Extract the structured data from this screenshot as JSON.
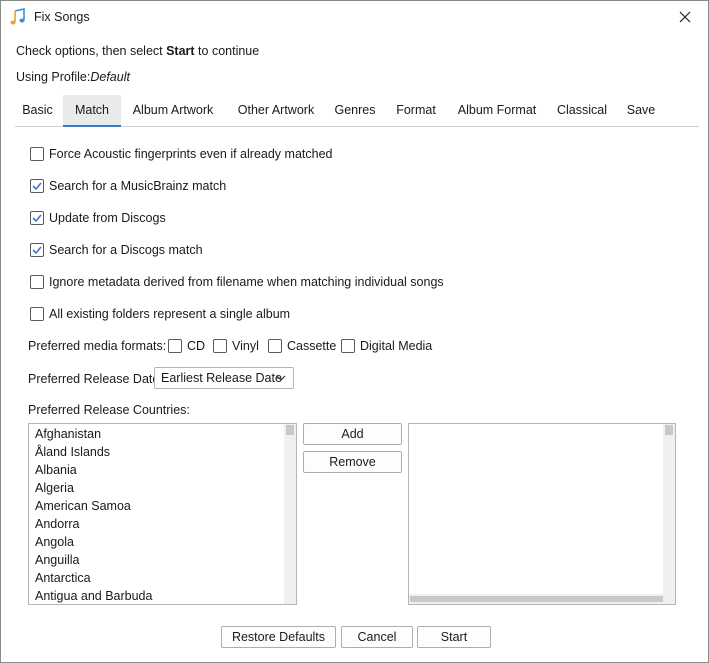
{
  "window": {
    "title": "Fix Songs",
    "icon": "music-note-icon"
  },
  "instructions": {
    "prefix": "Check options, then select ",
    "bold": "Start",
    "suffix": " to continue"
  },
  "profile": {
    "label": "Using Profile:",
    "value": "Default"
  },
  "tabs": [
    {
      "label": "Basic"
    },
    {
      "label": "Match",
      "active": true
    },
    {
      "label": "Album Artwork"
    },
    {
      "label": "Other Artwork"
    },
    {
      "label": "Genres"
    },
    {
      "label": "Format"
    },
    {
      "label": "Album Format"
    },
    {
      "label": "Classical"
    },
    {
      "label": "Save"
    }
  ],
  "options": [
    {
      "label": "Force Acoustic fingerprints even if already matched",
      "checked": false
    },
    {
      "label": "Search for a MusicBrainz match",
      "checked": true
    },
    {
      "label": "Update from Discogs",
      "checked": true
    },
    {
      "label": "Search for a Discogs match",
      "checked": true
    },
    {
      "label": "Ignore metadata derived from filename when matching individual songs",
      "checked": false
    },
    {
      "label": "All existing folders represent a single album",
      "checked": false
    }
  ],
  "media_formats": {
    "label": "Preferred media formats:",
    "items": [
      {
        "label": "CD",
        "checked": false
      },
      {
        "label": "Vinyl",
        "checked": false
      },
      {
        "label": "Cassette",
        "checked": false
      },
      {
        "label": "Digital Media",
        "checked": false
      }
    ]
  },
  "release_date": {
    "label": "Preferred Release Date:",
    "value": "Earliest Release Date"
  },
  "countries": {
    "label": "Preferred Release Countries:",
    "available": [
      "Afghanistan",
      "Åland Islands",
      "Albania",
      "Algeria",
      "American Samoa",
      "Andorra",
      "Angola",
      "Anguilla",
      "Antarctica",
      "Antigua and Barbuda"
    ],
    "selected": []
  },
  "buttons": {
    "add": "Add",
    "remove": "Remove",
    "restore": "Restore Defaults",
    "cancel": "Cancel",
    "start": "Start"
  },
  "colors": {
    "accent": "#3b78c9",
    "tab_active_bg": "#e9eaeb"
  }
}
